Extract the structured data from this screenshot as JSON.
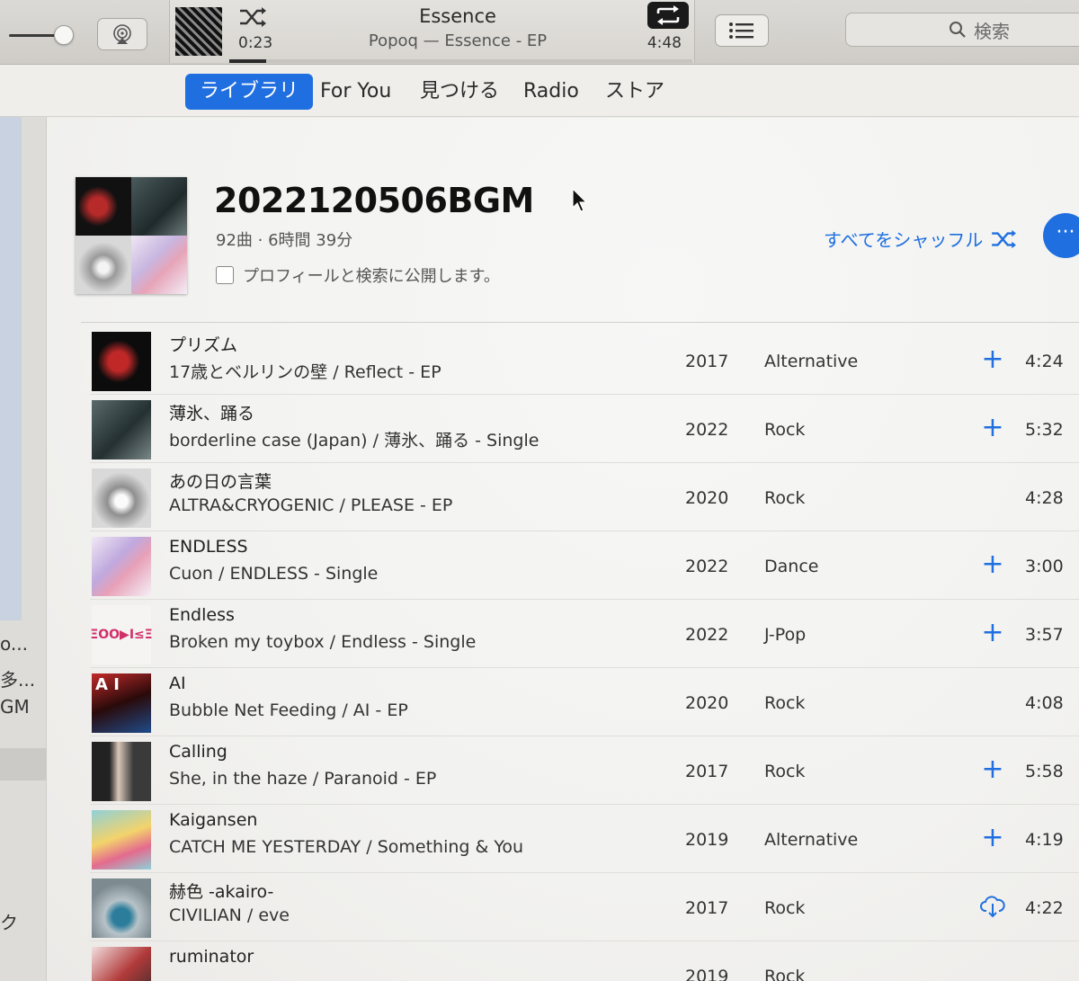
{
  "player": {
    "elapsed": "0:23",
    "duration": "4:48",
    "track_title": "Essence",
    "track_subtitle": "Popoq — Essence - EP",
    "progress_fraction": 0.08
  },
  "search": {
    "placeholder": "検索"
  },
  "tabs": [
    {
      "label": "ライブラリ",
      "active": true
    },
    {
      "label": "For You",
      "active": false
    },
    {
      "label": "見つける",
      "active": false
    },
    {
      "label": "Radio",
      "active": false
    },
    {
      "label": "ストア",
      "active": false
    }
  ],
  "sidebar": {
    "items": [
      {
        "label": "o..."
      },
      {
        "label": "多..."
      },
      {
        "label": "GM"
      },
      {
        "label": "ク"
      }
    ]
  },
  "playlist": {
    "title": "2022120506BGM",
    "meta": "92曲 · 6時間 39分",
    "publish_label": "プロフィールと検索に公開します。",
    "shuffle_all_label": "すべてをシャッフル",
    "more_label": "···"
  },
  "tracks": [
    {
      "title": "プリズム",
      "subtitle": "17歳とベルリンの壁 / Reflect - EP",
      "year": "2017",
      "genre": "Alternative",
      "action": "add",
      "time": "4:24"
    },
    {
      "title": "薄氷、踊る",
      "subtitle": "borderline case (Japan) / 薄氷、踊る - Single",
      "year": "2022",
      "genre": "Rock",
      "action": "add",
      "time": "5:32"
    },
    {
      "title": "あの日の言葉",
      "subtitle": "ALTRA&CRYOGENIC / PLEASE - EP",
      "year": "2020",
      "genre": "Rock",
      "action": "none",
      "time": "4:28"
    },
    {
      "title": "ENDLESS",
      "subtitle": "Cuon / ENDLESS - Single",
      "year": "2022",
      "genre": "Dance",
      "action": "add",
      "time": "3:00"
    },
    {
      "title": "Endless",
      "subtitle": "Broken my toybox / Endless - Single",
      "year": "2022",
      "genre": "J-Pop",
      "action": "add",
      "time": "3:57"
    },
    {
      "title": "AI",
      "subtitle": "Bubble Net Feeding / AI - EP",
      "year": "2020",
      "genre": "Rock",
      "action": "none",
      "time": "4:08"
    },
    {
      "title": "Calling",
      "subtitle": "She, in the haze / Paranoid - EP",
      "year": "2017",
      "genre": "Rock",
      "action": "add",
      "time": "5:58"
    },
    {
      "title": "Kaigansen",
      "subtitle": "CATCH ME YESTERDAY / Something & You",
      "year": "2019",
      "genre": "Alternative",
      "action": "add",
      "time": "4:19"
    },
    {
      "title": "赫色 -akairo-",
      "subtitle": "CIVILIAN / eve",
      "year": "2017",
      "genre": "Rock",
      "action": "download",
      "time": "4:22"
    },
    {
      "title": "ruminator",
      "subtitle": "",
      "year": "2019",
      "genre": "Rock",
      "action": "none",
      "time": ""
    }
  ],
  "art_labels": {
    "endless": "ΞOO▶I≤Ξ",
    "ai": "A I"
  },
  "colors": {
    "accent": "#1f6fe0"
  },
  "icons": [
    "shuffle-icon",
    "repeat-icon",
    "airplay-icon",
    "list-icon",
    "search-icon",
    "cursor-icon",
    "add-icon",
    "cloud-download-icon"
  ]
}
